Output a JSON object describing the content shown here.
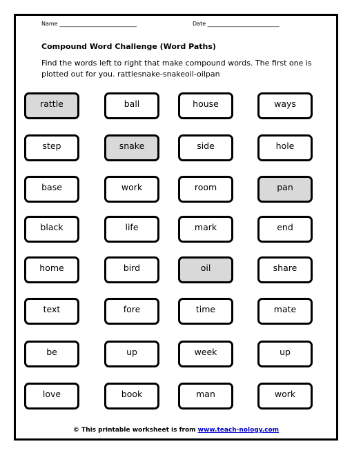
{
  "header": {
    "name_label": "Name ____________________________",
    "date_label": "Date __________________________"
  },
  "title": "Compound Word Challenge (Word Paths)",
  "instructions": "Find the words left to right that make compound words. The first one is plotted out for you. rattlesnake-snakeoil-oilpan",
  "highlight_color": "#d9d9d9",
  "grid": [
    [
      {
        "word": "rattle",
        "highlighted": true
      },
      {
        "word": "ball",
        "highlighted": false
      },
      {
        "word": "house",
        "highlighted": false
      },
      {
        "word": "ways",
        "highlighted": false
      }
    ],
    [
      {
        "word": "step",
        "highlighted": false
      },
      {
        "word": "snake",
        "highlighted": true
      },
      {
        "word": "side",
        "highlighted": false
      },
      {
        "word": "hole",
        "highlighted": false
      }
    ],
    [
      {
        "word": "base",
        "highlighted": false
      },
      {
        "word": "work",
        "highlighted": false
      },
      {
        "word": "room",
        "highlighted": false
      },
      {
        "word": "pan",
        "highlighted": true
      }
    ],
    [
      {
        "word": "black",
        "highlighted": false
      },
      {
        "word": "life",
        "highlighted": false
      },
      {
        "word": "mark",
        "highlighted": false
      },
      {
        "word": "end",
        "highlighted": false
      }
    ],
    [
      {
        "word": "home",
        "highlighted": false
      },
      {
        "word": "bird",
        "highlighted": false
      },
      {
        "word": "oil",
        "highlighted": true
      },
      {
        "word": "share",
        "highlighted": false
      }
    ],
    [
      {
        "word": "text",
        "highlighted": false
      },
      {
        "word": "fore",
        "highlighted": false
      },
      {
        "word": "time",
        "highlighted": false
      },
      {
        "word": "mate",
        "highlighted": false
      }
    ],
    [
      {
        "word": "be",
        "highlighted": false
      },
      {
        "word": "up",
        "highlighted": false
      },
      {
        "word": "week",
        "highlighted": false
      },
      {
        "word": "up",
        "highlighted": false
      }
    ],
    [
      {
        "word": "love",
        "highlighted": false
      },
      {
        "word": "book",
        "highlighted": false
      },
      {
        "word": "man",
        "highlighted": false
      },
      {
        "word": "work",
        "highlighted": false
      }
    ]
  ],
  "footer": {
    "text": "© This printable worksheet is from ",
    "link_text": "www.teach-nology.com"
  }
}
